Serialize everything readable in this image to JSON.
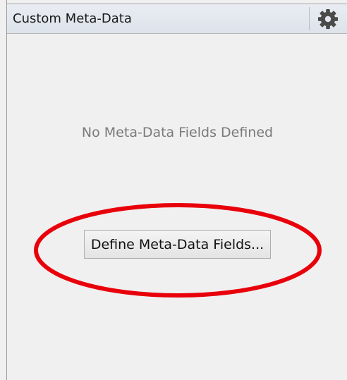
{
  "panel": {
    "title": "Custom Meta-Data",
    "settings_icon": "gear-icon"
  },
  "main": {
    "empty_message": "No Meta-Data Fields Defined",
    "define_button_label": "Define Meta-Data Fields..."
  },
  "annotation": {
    "shape": "ellipse",
    "color": "#e8000b"
  },
  "colors": {
    "panel_background": "#f0f0f0",
    "header_background": "#e3e8ee",
    "muted_text": "#7a7a7a"
  }
}
